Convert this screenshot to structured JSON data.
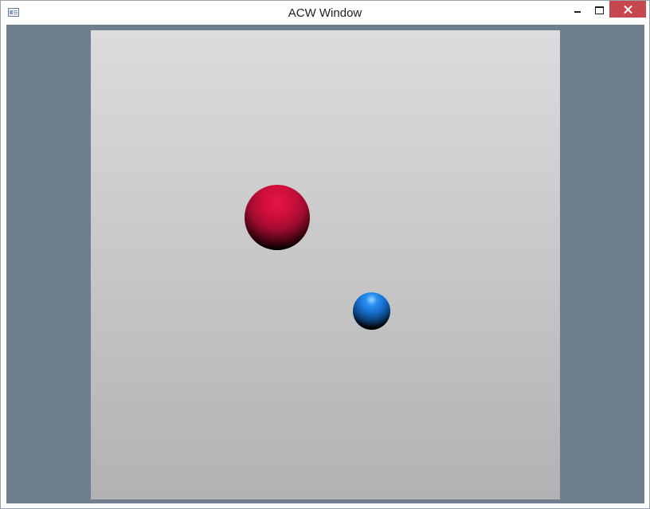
{
  "window": {
    "title": "ACW Window"
  },
  "titlebar": {
    "icon": "app-window-icon",
    "controls": {
      "minimize_icon": "minimize-icon",
      "maximize_icon": "maximize-icon",
      "close_icon": "close-icon",
      "close_color": "#c7474e"
    }
  },
  "scene": {
    "background_color": "#6f7f8f",
    "viewport_gradient": [
      "#dcdcdc",
      "#b2b2b2"
    ],
    "objects": [
      {
        "name": "red-sphere",
        "color": "#d2103d"
      },
      {
        "name": "blue-sphere",
        "color": "#1f7fe0"
      }
    ]
  }
}
